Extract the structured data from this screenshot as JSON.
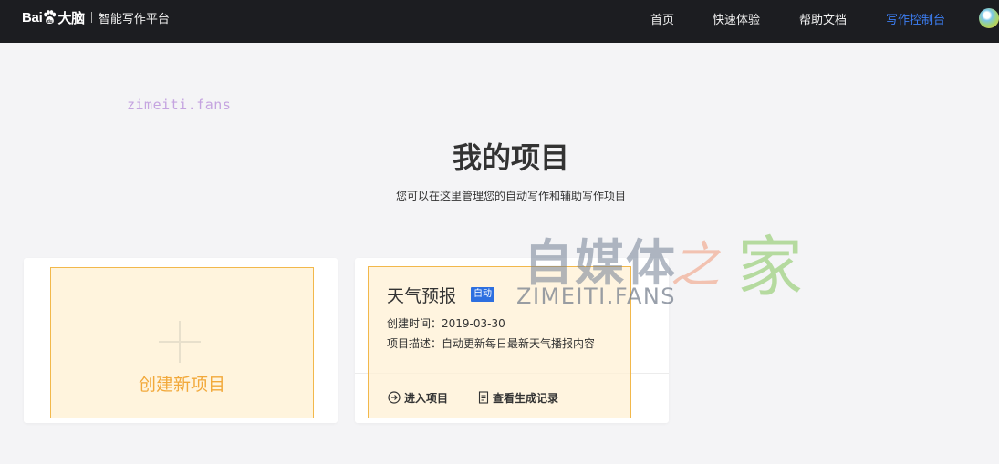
{
  "header": {
    "logo_text_bai": "Bai",
    "logo_text_du": "大脑",
    "product_name": "智能写作平台",
    "nav": [
      {
        "label": "首页",
        "active": false
      },
      {
        "label": "快速体验",
        "active": false
      },
      {
        "label": "帮助文档",
        "active": false
      },
      {
        "label": "写作控制台",
        "active": true
      }
    ],
    "accent_color": "#3d7ff5",
    "bg_color": "#1c1d21"
  },
  "watermark": {
    "small": "zimeiti.fans",
    "big_cn": "自媒体",
    "big_zhi": "之",
    "big_jia": "家",
    "big_latin": "ZIMEITI.FANS"
  },
  "main": {
    "title": "我的项目",
    "subtitle": "您可以在这里管理您的自动写作和辅助写作项目",
    "new_project": {
      "label": "创建新项目",
      "icon": "plus-icon",
      "accent_color": "#f2a93b"
    },
    "projects": [
      {
        "name": "天气预报",
        "tag": "自动",
        "created_label": "创建时间：",
        "created": "2019-03-30",
        "desc_label": "项目描述：",
        "desc": "自动更新每日最新天气播报内容",
        "actions": [
          {
            "label": "进入项目",
            "icon": "arrow-circle-icon"
          },
          {
            "label": "查看生成记录",
            "icon": "document-icon"
          }
        ]
      }
    ]
  }
}
